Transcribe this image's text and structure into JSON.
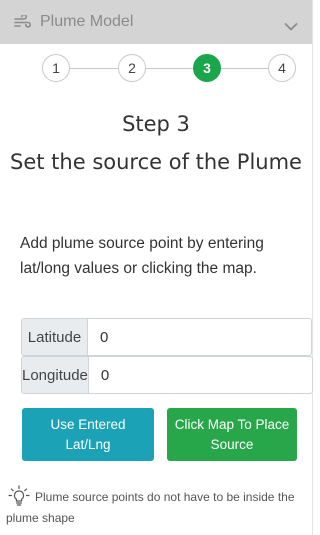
{
  "header": {
    "title": "Plume Model",
    "icon": "wind-icon",
    "toggle_icon": "chevron-down-icon"
  },
  "stepper": {
    "steps": [
      "1",
      "2",
      "3",
      "4"
    ],
    "active_step": 3,
    "active_color": "#1aa64a"
  },
  "main": {
    "heading": "Step 3",
    "title": "Set the source of the Plume",
    "description": "Add plume source point by entering lat/long values or clicking the map."
  },
  "form": {
    "latitude": {
      "label": "Latitude",
      "value": "0"
    },
    "longitude": {
      "label": "Longitude",
      "value": "0"
    }
  },
  "buttons": {
    "use_entered": {
      "label": "Use Entered Lat/Lng",
      "color": "#1ba2b7"
    },
    "click_map": {
      "label": "Click Map To Place Source",
      "color": "#27a74a"
    }
  },
  "tip": {
    "icon": "lightbulb-icon",
    "text": "Plume source points do not have to be inside the plume shape"
  }
}
